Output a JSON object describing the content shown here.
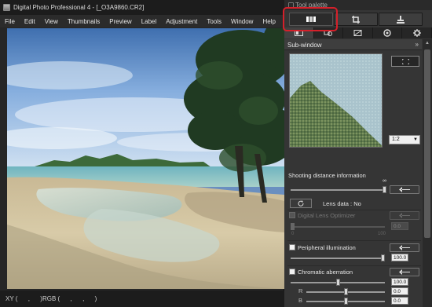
{
  "window": {
    "title": "Digital Photo Professional 4 - [_O3A9860.CR2]",
    "menu": [
      "File",
      "Edit",
      "View",
      "Thumbnails",
      "Preview",
      "Label",
      "Adjustment",
      "Tools",
      "Window",
      "Help"
    ],
    "status": "XY (      ,      )RGB (      ,      ,      )"
  },
  "palette": {
    "title": "Tool palette",
    "subwindow_label": "Sub-window",
    "zoom": "1:2",
    "shooting_distance_label": "Shooting distance information",
    "infinity_mark": "∞",
    "lens_data_label": "Lens data : No",
    "dual_lens_label": "Digital Lens Optimizer",
    "dual_lens_value": "0.0",
    "dual_lens_min": "0",
    "dual_lens_max": "100",
    "peripheral_label": "Peripheral illumination",
    "peripheral_value": "100.0",
    "chromatic_label": "Chromatic aberration",
    "chromatic_value": "100.0",
    "chromatic_r_label": "R",
    "chromatic_r_value": "0.0",
    "chromatic_b_label": "B",
    "chromatic_b_value": "0.0"
  },
  "sliders": {
    "shooting_distance": 1.0,
    "dual_lens": 0.0,
    "peripheral": 1.0,
    "chromatic": 0.5,
    "chromatic_r": 0.5,
    "chromatic_b": 0.5
  }
}
